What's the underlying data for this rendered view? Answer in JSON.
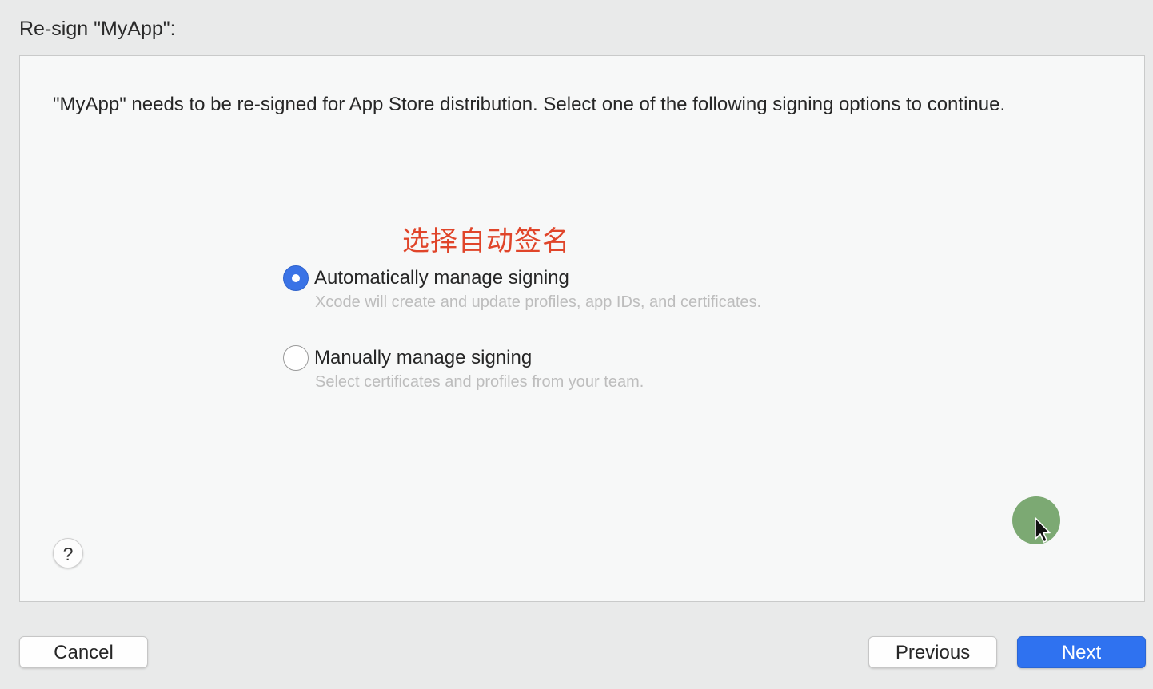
{
  "dialog": {
    "title": "Re-sign \"MyApp\":",
    "message": "\"MyApp\" needs to be re-signed for App Store distribution. Select one of the following signing options to continue.",
    "annotation": "选择自动签名",
    "options": [
      {
        "label": "Automatically manage signing",
        "description": "Xcode will create and update profiles, app IDs, and certificates.",
        "selected": true
      },
      {
        "label": "Manually manage signing",
        "description": "Select certificates and profiles from your team.",
        "selected": false
      }
    ],
    "help_label": "?"
  },
  "buttons": {
    "cancel": "Cancel",
    "previous": "Previous",
    "next": "Next"
  },
  "colors": {
    "accent": "#2f72f0",
    "annotation": "#e0452a",
    "cursor_highlight": "#6ea064"
  },
  "icons": {
    "cursor": "mouse-pointer-icon",
    "help": "question-mark-icon"
  }
}
